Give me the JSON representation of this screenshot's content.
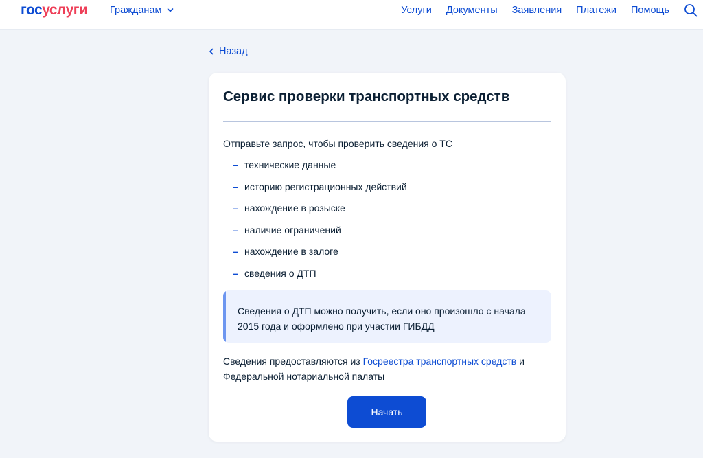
{
  "header": {
    "logo_part1": "гос",
    "logo_part2": "услуги",
    "audience_label": "Гражданам",
    "nav": [
      "Услуги",
      "Документы",
      "Заявления",
      "Платежи",
      "Помощь"
    ],
    "icons": {
      "search": "search-icon",
      "audience_chevron": "chevron-down-icon"
    }
  },
  "back": {
    "label": "Назад",
    "icon": "chevron-left-icon"
  },
  "card": {
    "title": "Сервис проверки транспортных средств",
    "intro": "Отправьте запрос, чтобы проверить сведения о ТС",
    "list_marker": "–",
    "items": [
      "технические данные",
      "историю регистрационных действий",
      "нахождение в розыске",
      "наличие ограничений",
      "нахождение в залоге",
      "сведения о ДТП"
    ],
    "info": "Сведения о ДТП можно получить, если оно произошло с начала 2015 года и оформлено при участии ГИБДД",
    "source_prefix": "Сведения предоставляются из ",
    "source_link": "Госреестра транспортных средств",
    "source_suffix": " и Федеральной нотариальной палаты",
    "start_button": "Начать"
  },
  "colors": {
    "accent": "#0d4cd3",
    "logo_red": "#ee3f58",
    "background": "#f1f4f9",
    "info_bg": "#edf2fe",
    "info_bar": "#6d96f0",
    "text": "#0b1f33"
  }
}
